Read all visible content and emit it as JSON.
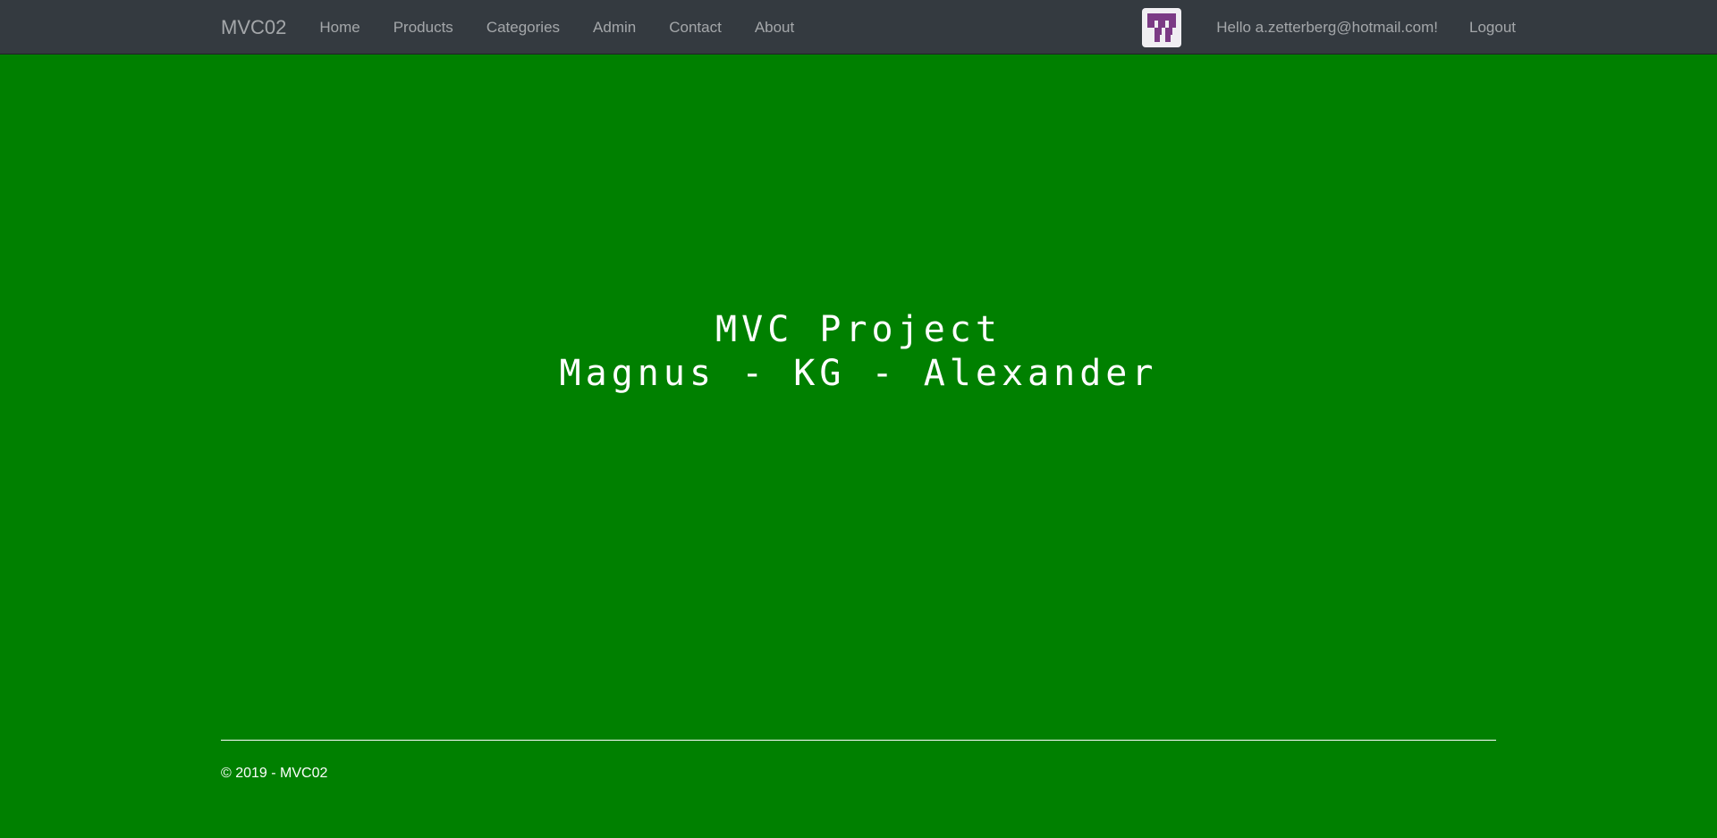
{
  "nav": {
    "brand": "MVC02",
    "links": [
      {
        "label": "Home"
      },
      {
        "label": "Products"
      },
      {
        "label": "Categories"
      },
      {
        "label": "Admin"
      },
      {
        "label": "Contact"
      },
      {
        "label": "About"
      }
    ],
    "greeting": "Hello a.zetterberg@hotmail.com!",
    "logout": "Logout",
    "avatar_icon": "identicon-avatar"
  },
  "hero": {
    "line1": "MVC Project",
    "line2": "Magnus - KG - Alexander"
  },
  "footer": {
    "copyright": "© 2019 - MVC02"
  },
  "colors": {
    "page_background": "#008000",
    "navbar_background": "#343a40",
    "avatar_accent": "#7b3a85"
  }
}
